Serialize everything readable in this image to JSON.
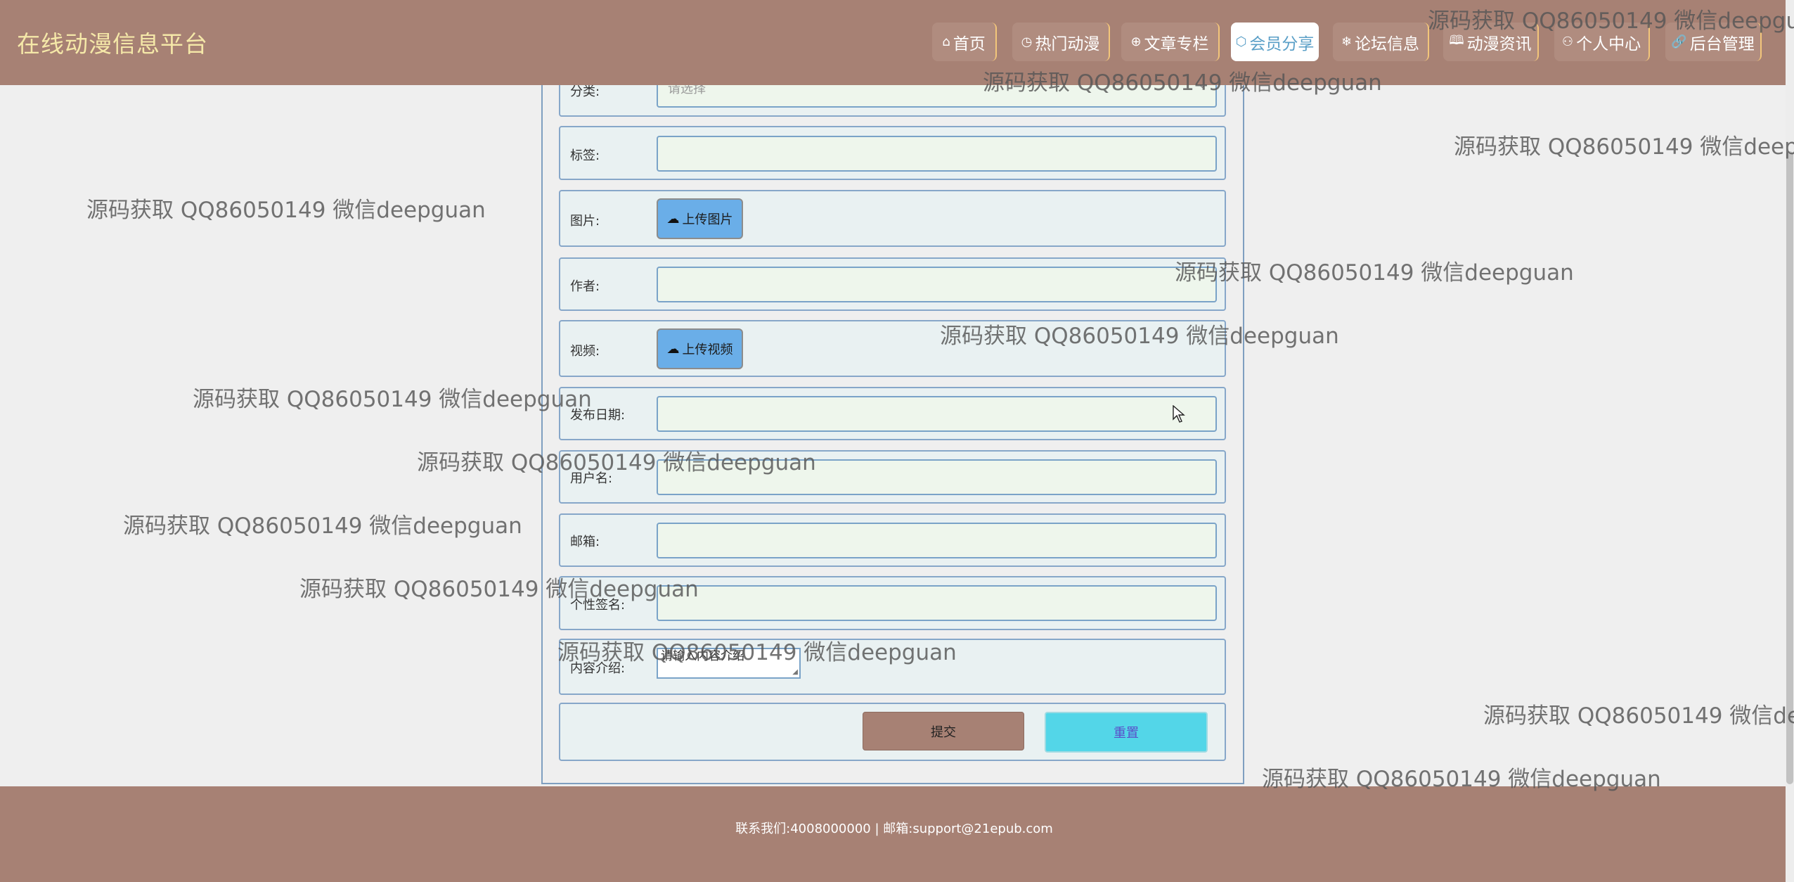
{
  "header": {
    "logo": "在线动漫信息平台",
    "nav": [
      {
        "label": "首页",
        "icon": "home-icon",
        "glyph": "⌂"
      },
      {
        "label": "热门动漫",
        "icon": "clock-icon",
        "glyph": "◷"
      },
      {
        "label": "文章专栏",
        "icon": "globe-icon",
        "glyph": "⊕"
      },
      {
        "label": "会员分享",
        "icon": "cube-icon",
        "glyph": "⬡"
      },
      {
        "label": "论坛信息",
        "icon": "snowflake-icon",
        "glyph": "❄"
      },
      {
        "label": "动漫资讯",
        "icon": "book-icon",
        "glyph": "🕮"
      },
      {
        "label": "个人中心",
        "icon": "user-icon",
        "glyph": "⚇"
      },
      {
        "label": "后台管理",
        "icon": "link-icon",
        "glyph": "🔗"
      }
    ]
  },
  "form": {
    "category_label": "分类:",
    "category_placeholder": "请选择",
    "tags_label": "标签:",
    "image_label": "图片:",
    "upload_image_label": "上传图片",
    "author_label": "作者:",
    "video_label": "视频:",
    "upload_video_label": "上传视频",
    "publish_date_label": "发布日期:",
    "username_label": "用户名:",
    "email_label": "邮箱:",
    "signature_label": "个性签名:",
    "intro_label": "内容介绍:",
    "intro_placeholder": "请输入内容介绍",
    "submit_label": "提交",
    "reset_label": "重置"
  },
  "footer": {
    "contact": "联系我们:4008000000 | 邮箱:support@21epub.com"
  },
  "watermark": "源码获取 QQ86050149 微信deepguan",
  "colors": {
    "header_bg": "#a78174",
    "logo": "#f5e8a8",
    "active_nav": "#5a9fc7",
    "upload_button": "#6aaee8",
    "submit_button": "#a78174",
    "reset_button": "#53d6e8"
  }
}
